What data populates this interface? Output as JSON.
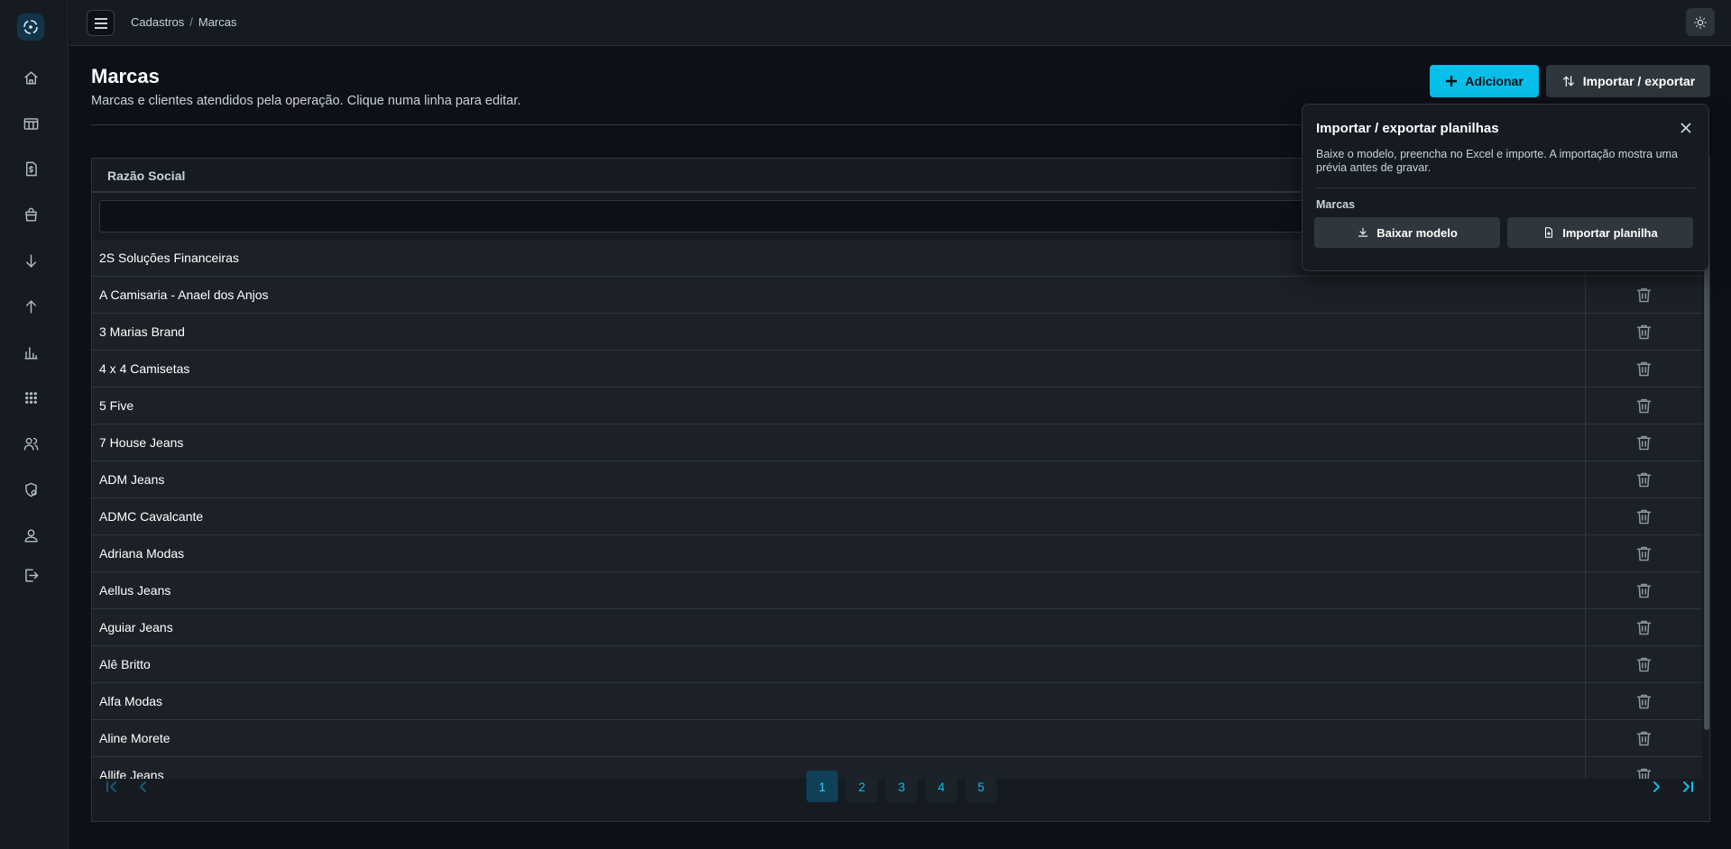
{
  "breadcrumb": {
    "parent": "Cadastros",
    "separator": "/",
    "current": "Marcas"
  },
  "page": {
    "title": "Marcas",
    "subtitle": "Marcas e clientes atendidos pela operação. Clique numa linha para editar."
  },
  "actions": {
    "add_label": "Adicionar",
    "import_label": "Importar / exportar"
  },
  "table": {
    "column_header": "Razão Social",
    "filter_value": "",
    "rows": [
      "2S Soluções Financeiras",
      "A Camisaria - Anael dos Anjos",
      "3 Marias Brand",
      "4 x 4 Camisetas",
      "5 Five",
      "7 House Jeans",
      "ADM Jeans",
      "ADMC Cavalcante",
      "Adriana Modas",
      "Aellus Jeans",
      "Aguiar Jeans",
      "Alê Britto",
      "Alfa Modas",
      "Aline Morete",
      "Allife Jeans"
    ]
  },
  "pagination": {
    "pages": [
      "1",
      "2",
      "3",
      "4",
      "5"
    ],
    "current": "1"
  },
  "popover": {
    "title": "Importar / exportar planilhas",
    "description": "Baixe o modelo, preencha no Excel e importe. A importação mostra uma prévia antes de gravar.",
    "section_label": "Marcas",
    "download_label": "Baixar modelo",
    "import_label": "Importar planilha"
  },
  "colors": {
    "accent": "#06bfea",
    "background": "#0d1117",
    "surface": "#161b22",
    "row": "#1c2128",
    "border": "#30363d"
  },
  "icons": {
    "sidebar": [
      "home-icon",
      "boxes-icon",
      "invoice-icon",
      "shopping-bag-icon",
      "arrow-down-icon",
      "arrow-up-icon",
      "bar-chart-icon",
      "grid-icon",
      "users-icon",
      "shield-user-icon",
      "user-icon",
      "logout-icon"
    ],
    "row_action": "trash-icon"
  }
}
